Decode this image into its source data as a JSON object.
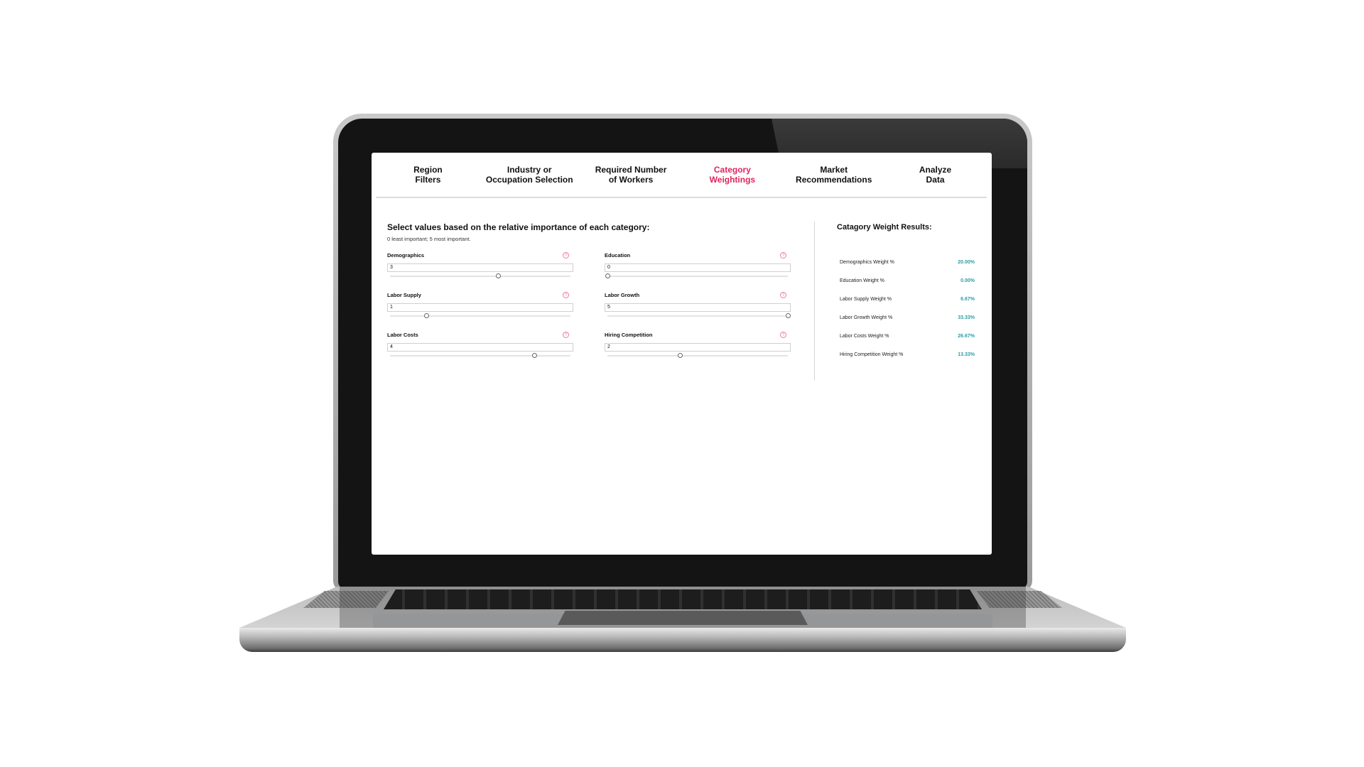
{
  "nav": {
    "tabs": [
      {
        "label": "Region\nFilters",
        "active": false
      },
      {
        "label": "Industry or\nOccupation Selection",
        "active": false
      },
      {
        "label": "Required Number\nof Workers",
        "active": false
      },
      {
        "label": "Category\nWeightings",
        "active": true
      },
      {
        "label": "Market\nRecommendations",
        "active": false
      },
      {
        "label": "Analyze\nData",
        "active": false
      }
    ]
  },
  "weights": {
    "heading": "Select values based on the relative importance of each category:",
    "subheading": "0 least important; 5 most important.",
    "scale_min": 0,
    "scale_max": 5,
    "help_icon": "?",
    "fields": [
      {
        "label": "Demographics",
        "value": "3"
      },
      {
        "label": "Education",
        "value": "0"
      },
      {
        "label": "Labor Supply",
        "value": "1"
      },
      {
        "label": "Labor Growth",
        "value": "5"
      },
      {
        "label": "Labor Costs",
        "value": "4"
      },
      {
        "label": "Hiring Competition",
        "value": "2"
      }
    ]
  },
  "results": {
    "title": "Catagory Weight Results:",
    "rows": [
      {
        "label": "Demographics Weight %",
        "value": "20.00%"
      },
      {
        "label": "Education Weight %",
        "value": "0.00%"
      },
      {
        "label": "Labor Supply Weight %",
        "value": "6.67%"
      },
      {
        "label": "Labor Growth Weight %",
        "value": "33.33%"
      },
      {
        "label": "Labor Costs Weight %",
        "value": "26.67%"
      },
      {
        "label": "Hiring Competition Weight %",
        "value": "13.33%"
      }
    ]
  },
  "colors": {
    "accent": "#e0245e",
    "result_value": "#2a9ea8",
    "help_icon": "#ec7c96"
  }
}
